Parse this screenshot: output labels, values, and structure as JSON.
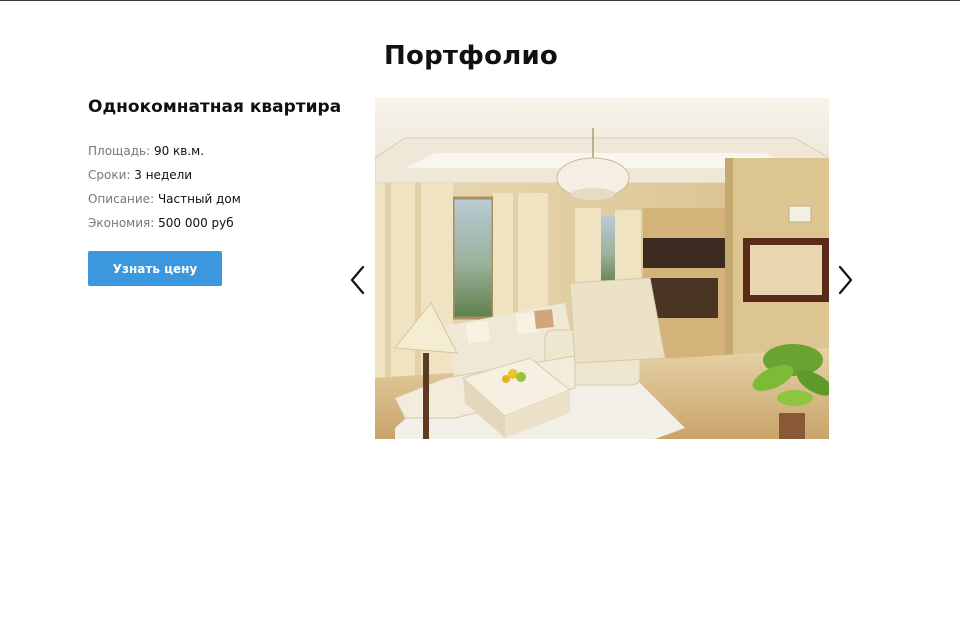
{
  "section": {
    "title": "Портфолио"
  },
  "project": {
    "title": "Однокомнатная квартира",
    "details": [
      {
        "label": "Площадь:",
        "value": "90 кв.м."
      },
      {
        "label": "Сроки:",
        "value": "3 недели"
      },
      {
        "label": "Описание:",
        "value": "Частный дом"
      },
      {
        "label": "Экономия:",
        "value": "500 000 руб"
      }
    ],
    "button_label": "Узнать цену"
  },
  "slider": {
    "prev_icon": "chevron-left-icon",
    "next_icon": "chevron-right-icon",
    "image_subject": "living-room-interior"
  },
  "colors": {
    "button": "#3b97de",
    "title": "#111111",
    "label": "#777777"
  }
}
